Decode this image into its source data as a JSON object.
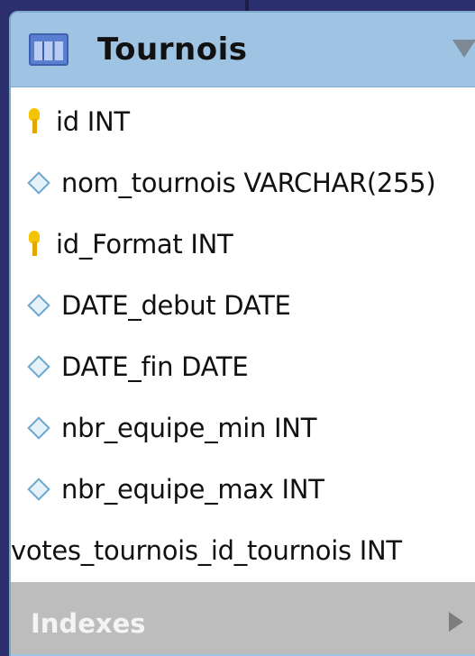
{
  "table": {
    "title": "Tournois",
    "icon": "table-icon",
    "columns": [
      {
        "name": "id INT",
        "icon": "primary-key-icon"
      },
      {
        "name": "nom_tournois VARCHAR(255)",
        "icon": "column-diamond-icon"
      },
      {
        "name": "id_Format INT",
        "icon": "primary-key-icon"
      },
      {
        "name": "DATE_debut DATE",
        "icon": "column-diamond-icon"
      },
      {
        "name": "DATE_fin DATE",
        "icon": "column-diamond-icon"
      },
      {
        "name": "nbr_equipe_min INT",
        "icon": "column-diamond-icon"
      },
      {
        "name": "nbr_equipe_max INT",
        "icon": "column-diamond-icon"
      },
      {
        "name": "votes_tournois_id_tournois INT",
        "icon": ""
      }
    ],
    "indexes_label": "Indexes"
  },
  "colors": {
    "background": "#2c2f6e",
    "header": "#9fc3e2",
    "indexes_bar": "#bdbdbd",
    "key": "#f5c400"
  }
}
